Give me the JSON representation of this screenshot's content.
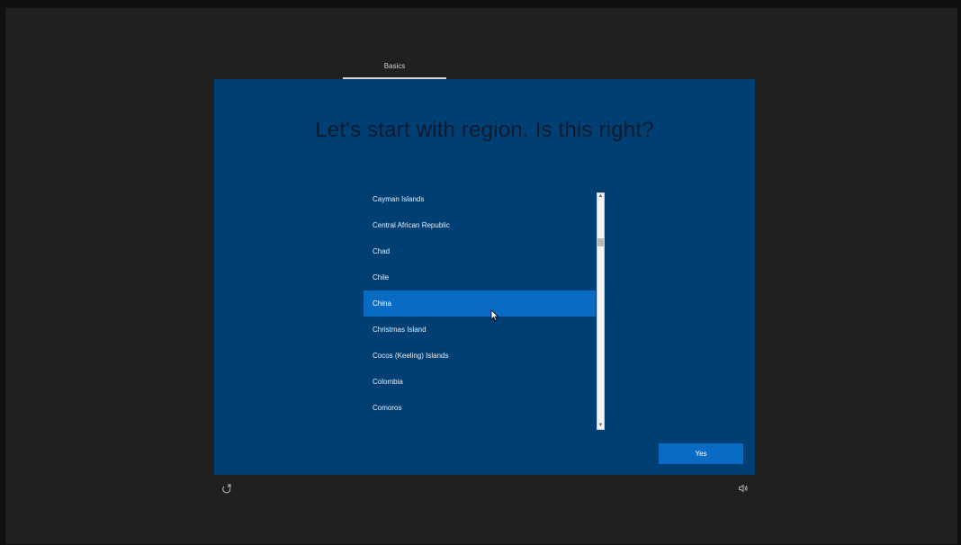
{
  "header": {
    "tab_label": "Basics"
  },
  "main": {
    "title": "Let's start with region. Is this right?",
    "regions": [
      "Cayman Islands",
      "Central African Republic",
      "Chad",
      "Chile",
      "China",
      "Christmas Island",
      "Cocos (Keeling) Islands",
      "Colombia",
      "Comoros"
    ],
    "selected_region": "China",
    "yes_label": "Yes"
  },
  "footer": {
    "left_icon": "accessibility-icon",
    "right_icon": "volume-icon"
  },
  "colors": {
    "panel": "#003f73",
    "accent": "#0a6bc4",
    "background": "#202020"
  }
}
